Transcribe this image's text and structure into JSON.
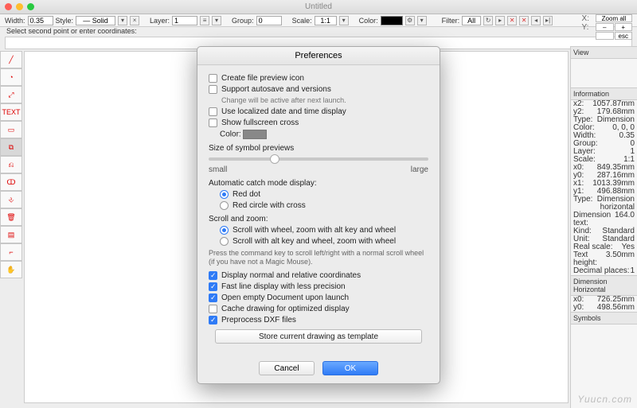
{
  "window": {
    "title": "Untitled"
  },
  "toolbar": {
    "width_label": "Width:",
    "width_value": "0.35",
    "style_label": "Style:",
    "style_value": "— Solid",
    "x_button": "×",
    "layer_label": "Layer:",
    "layer_value": "1",
    "group_label": "Group:",
    "group_value": "0",
    "scale_label": "Scale:",
    "scale_value": "1:1",
    "color_label": "Color:",
    "filter_label": "Filter:",
    "filter_value": "All"
  },
  "hint": "Select second point or enter coordinates:",
  "xy": {
    "x_label": "X:",
    "y_label": "Y:"
  },
  "zoom": {
    "all": "Zoom all",
    "minus": "–",
    "plus": "+",
    "esc": "esc"
  },
  "left_tools": [
    "line-tool",
    "circle-tool",
    "dimension-tool",
    "text-tool",
    "rect-tool",
    "crop-tool",
    "offset-tool",
    "group-tool",
    "ungroup-tool",
    "trash-tool",
    "hatch-tool",
    "corner-tool",
    "hand-tool"
  ],
  "left_tools_labels": [
    "╱",
    "◔",
    "⤢",
    "TEXT",
    "▭",
    "⧉",
    "⎌",
    "ↀ",
    "⎀",
    "🗑",
    "▤",
    "⌐",
    "✋"
  ],
  "panel": {
    "view_header": "View",
    "info_header": "Information",
    "rows": [
      [
        "x2:",
        "1057.87mm"
      ],
      [
        "y2:",
        "179.68mm"
      ],
      [
        "Type:",
        "Dimension"
      ],
      [
        "Color:",
        "0, 0, 0"
      ],
      [
        "Width:",
        "0.35"
      ],
      [
        "Group:",
        "0"
      ],
      [
        "Layer:",
        "1"
      ],
      [
        "Scale:",
        "1:1"
      ],
      [
        "x0:",
        "849.35mm"
      ],
      [
        "y0:",
        "287.16mm"
      ],
      [
        "x1:",
        "1013.39mm"
      ],
      [
        "y1:",
        "496.88mm"
      ],
      [
        "Type:",
        "Dimension horizontal"
      ],
      [
        "Dimension text:",
        "164.0"
      ],
      [
        "Kind:",
        "Standard"
      ],
      [
        "Unit:",
        "Standard"
      ],
      [
        "Real scale:",
        "Yes"
      ],
      [
        "Text height:",
        "3.50mm"
      ],
      [
        "Decimal places:",
        "1"
      ]
    ],
    "dim_header": "Dimension Horizontal",
    "dim_rows": [
      [
        "x0:",
        "726.25mm"
      ],
      [
        "y0:",
        "498.56mm"
      ]
    ],
    "symbols_header": "Symbols"
  },
  "prefs": {
    "title": "Preferences",
    "c1": "Create file preview icon",
    "c2": "Support autosave and versions",
    "c2_sub": "Change will be active after next launch.",
    "c3": "Use localized date and time display",
    "c4": "Show fullscreen cross",
    "color_label": "Color:",
    "size_label": "Size of symbol previews",
    "small": "small",
    "large": "large",
    "auto_label": "Automatic catch mode display:",
    "r1": "Red dot",
    "r2": "Red circle with cross",
    "scroll_label": "Scroll and zoom:",
    "s1": "Scroll with wheel, zoom with alt key and wheel",
    "s2": "Scroll with alt key and wheel, zoom with wheel",
    "note": "Press the command key to scroll left/right with a normal scroll wheel (if you have not a Magic Mouse).",
    "c5": "Display normal and relative coordinates",
    "c6": "Fast line display with less precision",
    "c7": "Open empty Document upon launch",
    "c8": "Cache drawing for optimized display",
    "c9": "Preprocess DXF files",
    "template_btn": "Store current drawing as template",
    "cancel": "Cancel",
    "ok": "OK"
  },
  "watermark": "Yuucn.com"
}
